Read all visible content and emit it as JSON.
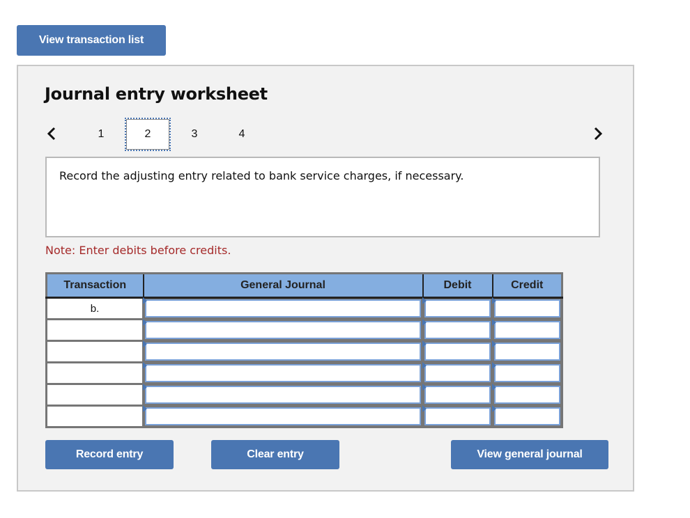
{
  "top_button": {
    "label": "View transaction list"
  },
  "worksheet": {
    "title": "Journal entry worksheet",
    "nav": {
      "prev_icon": "chevron-left-icon",
      "next_icon": "chevron-right-icon",
      "pages": [
        "1",
        "2",
        "3",
        "4"
      ],
      "active_page": "2"
    },
    "description": "Record the adjusting entry related to bank service charges, if necessary.",
    "note": "Note: Enter debits before credits.",
    "table": {
      "headers": [
        "Transaction",
        "General Journal",
        "Debit",
        "Credit"
      ],
      "rows": [
        {
          "transaction": "b.",
          "general_journal": "",
          "debit": "",
          "credit": ""
        },
        {
          "transaction": "",
          "general_journal": "",
          "debit": "",
          "credit": ""
        },
        {
          "transaction": "",
          "general_journal": "",
          "debit": "",
          "credit": ""
        },
        {
          "transaction": "",
          "general_journal": "",
          "debit": "",
          "credit": ""
        },
        {
          "transaction": "",
          "general_journal": "",
          "debit": "",
          "credit": ""
        },
        {
          "transaction": "",
          "general_journal": "",
          "debit": "",
          "credit": ""
        }
      ]
    },
    "buttons": {
      "record": "Record entry",
      "clear": "Clear entry",
      "view_general_journal": "View general journal"
    }
  },
  "colors": {
    "button_blue": "#4a76b2",
    "header_blue": "#84aee0",
    "note_red": "#a52a2a",
    "panel_bg": "#f2f2f2"
  }
}
